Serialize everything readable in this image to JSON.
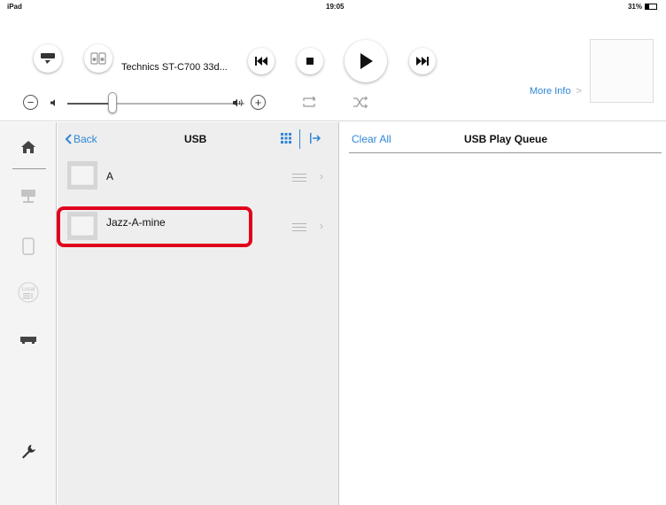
{
  "status_bar": {
    "device": "iPad",
    "time": "19:05",
    "battery": "31%"
  },
  "player": {
    "device_name": "Technics ST-C700 33d...",
    "more_info": "More Info",
    "more_info_chevron": ">",
    "volume_level": 0.25,
    "volume_minus": "−",
    "volume_plus": "+"
  },
  "icons": {
    "sidebar": [
      "home-icon",
      "network-server-icon",
      "tablet-icon",
      "local-music-icon",
      "usb-drive-icon",
      "wrench-icon"
    ],
    "header": [
      "speaker-select-icon",
      "device-icon",
      "previous-icon",
      "stop-icon",
      "play-icon",
      "next-icon",
      "repeat-icon",
      "shuffle-icon"
    ]
  },
  "browser": {
    "back_label": "Back",
    "title": "USB",
    "items": [
      {
        "label": "A"
      },
      {
        "label": "Jazz-A-mine"
      }
    ]
  },
  "queue": {
    "clear_all": "Clear All",
    "title": "USB Play Queue"
  },
  "colors": {
    "accent": "#2f86d8",
    "highlight": "#e1001a"
  }
}
